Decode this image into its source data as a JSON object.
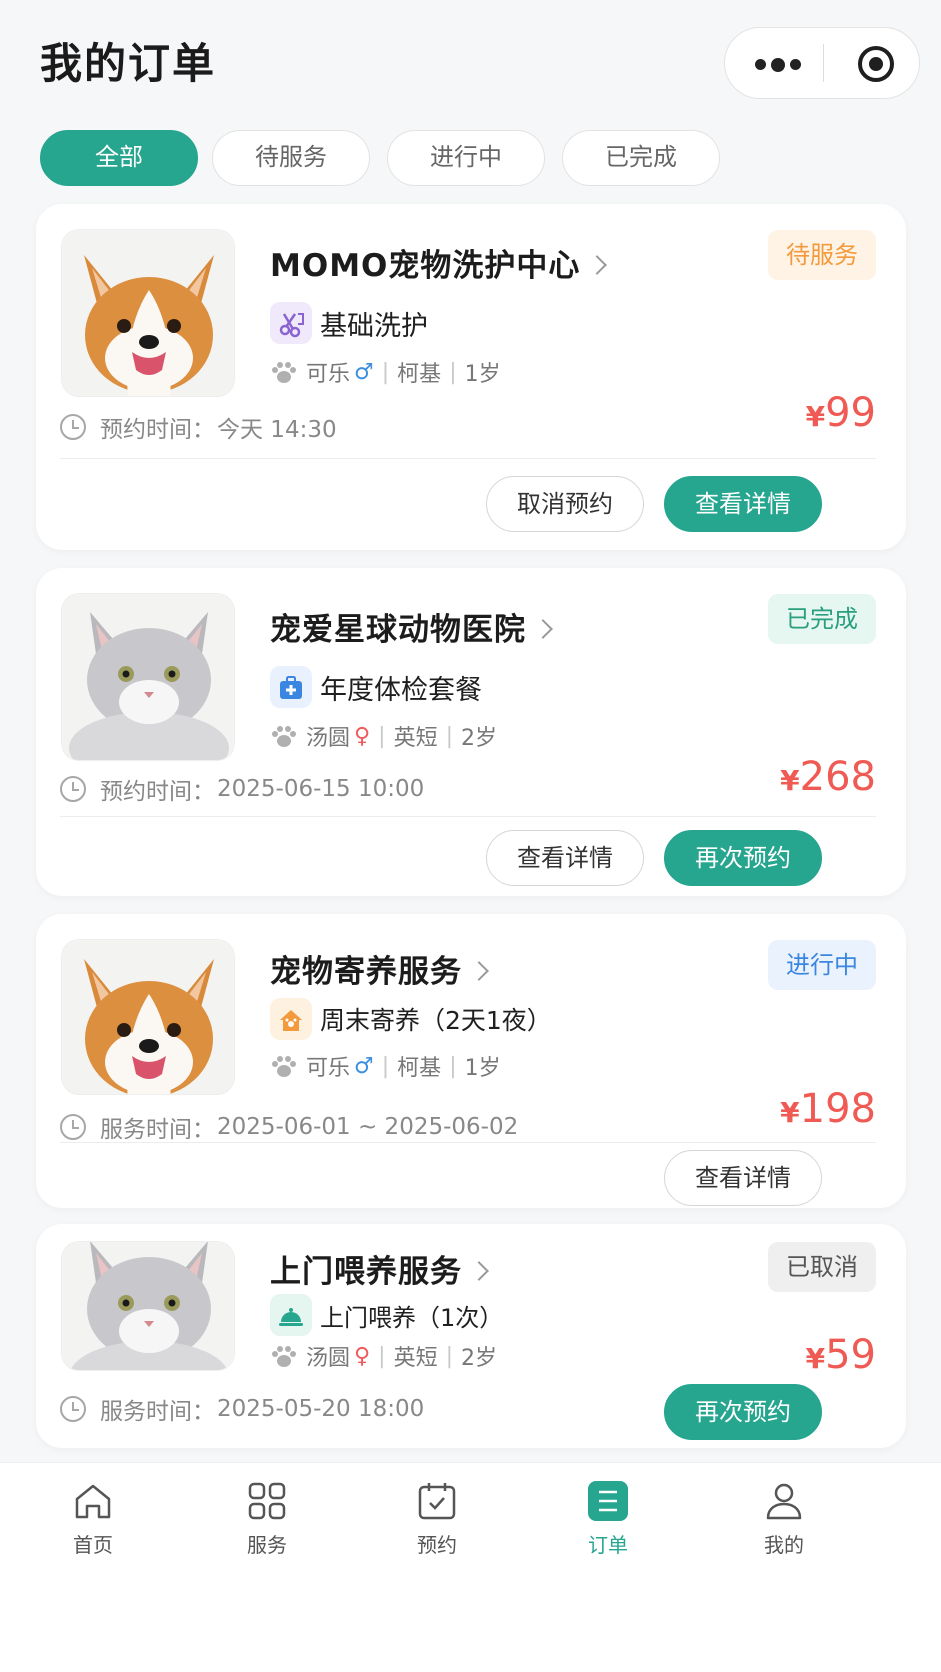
{
  "header": {
    "title": "我的订单"
  },
  "tabs": [
    {
      "label": "全部",
      "active": true
    },
    {
      "label": "待服务",
      "active": false
    },
    {
      "label": "进行中",
      "active": false
    },
    {
      "label": "已完成",
      "active": false
    }
  ],
  "orders": [
    {
      "shop": "MOMO宠物洗护中心",
      "status": "待服务",
      "status_color": "#f39a3c",
      "status_bg": "#fff3e6",
      "service": "基础洗护",
      "service_icon": "grooming-scissors-icon",
      "pet_name": "可乐",
      "pet_gender": "♂",
      "pet_breed": "柯基",
      "pet_age": "1岁",
      "time_label": "预约时间：",
      "time_value": "今天  14:30",
      "currency": "¥",
      "price": "99",
      "buttons": [
        "取消预约",
        "查看详情"
      ]
    },
    {
      "shop": "宠爱星球动物医院",
      "status": "已完成",
      "status_color": "#2a9f7e",
      "status_bg": "#e6f6f0",
      "service": "年度体检套餐",
      "service_icon": "medical-kit-icon",
      "pet_name": "汤圆",
      "pet_gender": "♀",
      "pet_breed": "英短",
      "pet_age": "2岁",
      "time_label": "预约时间：",
      "time_value": "2025-06-15  10:00",
      "currency": "¥",
      "price": "268",
      "buttons": [
        "查看详情",
        "再次预约"
      ]
    },
    {
      "shop": "宠物寄养服务",
      "status": "进行中",
      "status_color": "#3b86e0",
      "status_bg": "#eaf3fd",
      "service": "周末寄养（2天1夜）",
      "service_icon": "pet-house-icon",
      "pet_name": "可乐",
      "pet_gender": "♂",
      "pet_breed": "柯基",
      "pet_age": "1岁",
      "time_label": "服务时间：",
      "time_value": "2025-06-01 ~ 2025-06-02",
      "currency": "¥",
      "price": "198",
      "buttons": [
        "查看详情"
      ]
    },
    {
      "shop": "上门喂养服务",
      "status": "已取消",
      "status_color": "#555555",
      "status_bg": "#efefef",
      "service": "上门喂养（1次）",
      "service_icon": "food-bell-icon",
      "pet_name": "汤圆",
      "pet_gender": "♀",
      "pet_breed": "英短",
      "pet_age": "2岁",
      "time_label": "服务时间：",
      "time_value": "2025-05-20  18:00",
      "currency": "¥",
      "price": "59",
      "buttons": [
        "再次预约"
      ]
    }
  ],
  "tabbar": [
    {
      "label": "首页",
      "icon": "home-icon"
    },
    {
      "label": "服务",
      "icon": "grid-icon"
    },
    {
      "label": "预约",
      "icon": "calendar-icon"
    },
    {
      "label": "订单",
      "icon": "order-list-icon",
      "active": true
    },
    {
      "label": "我的",
      "icon": "user-icon"
    }
  ],
  "colors": {
    "accent": "#26a58f",
    "price": "#ef5b54"
  }
}
